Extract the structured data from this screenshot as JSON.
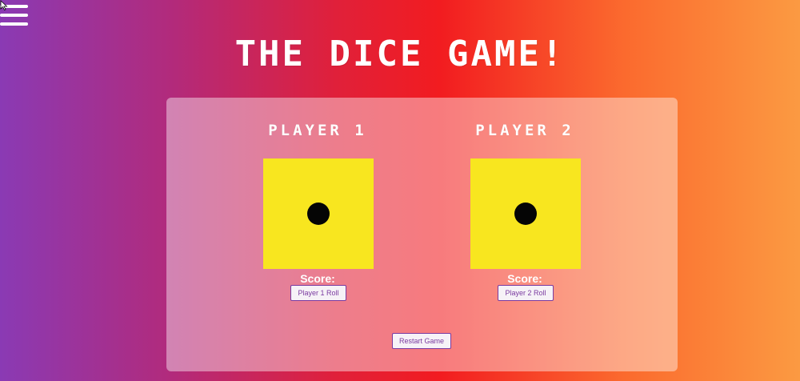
{
  "app": {
    "title": "The Dice Game!"
  },
  "players": [
    {
      "name": "Player 1",
      "die_face": 1,
      "score_label": "Score:",
      "roll_label": "Player 1 Roll"
    },
    {
      "name": "Player 2",
      "die_face": 1,
      "score_label": "Score:",
      "roll_label": "Player 2 Roll"
    }
  ],
  "controls": {
    "restart_label": "Restart Game"
  },
  "icons": {
    "menu": "hamburger-menu-icon",
    "cursor": "mouse-cursor-icon"
  },
  "colors": {
    "die": "#f8e61f",
    "pip": "#050505",
    "button_text": "#7a3aa0"
  }
}
